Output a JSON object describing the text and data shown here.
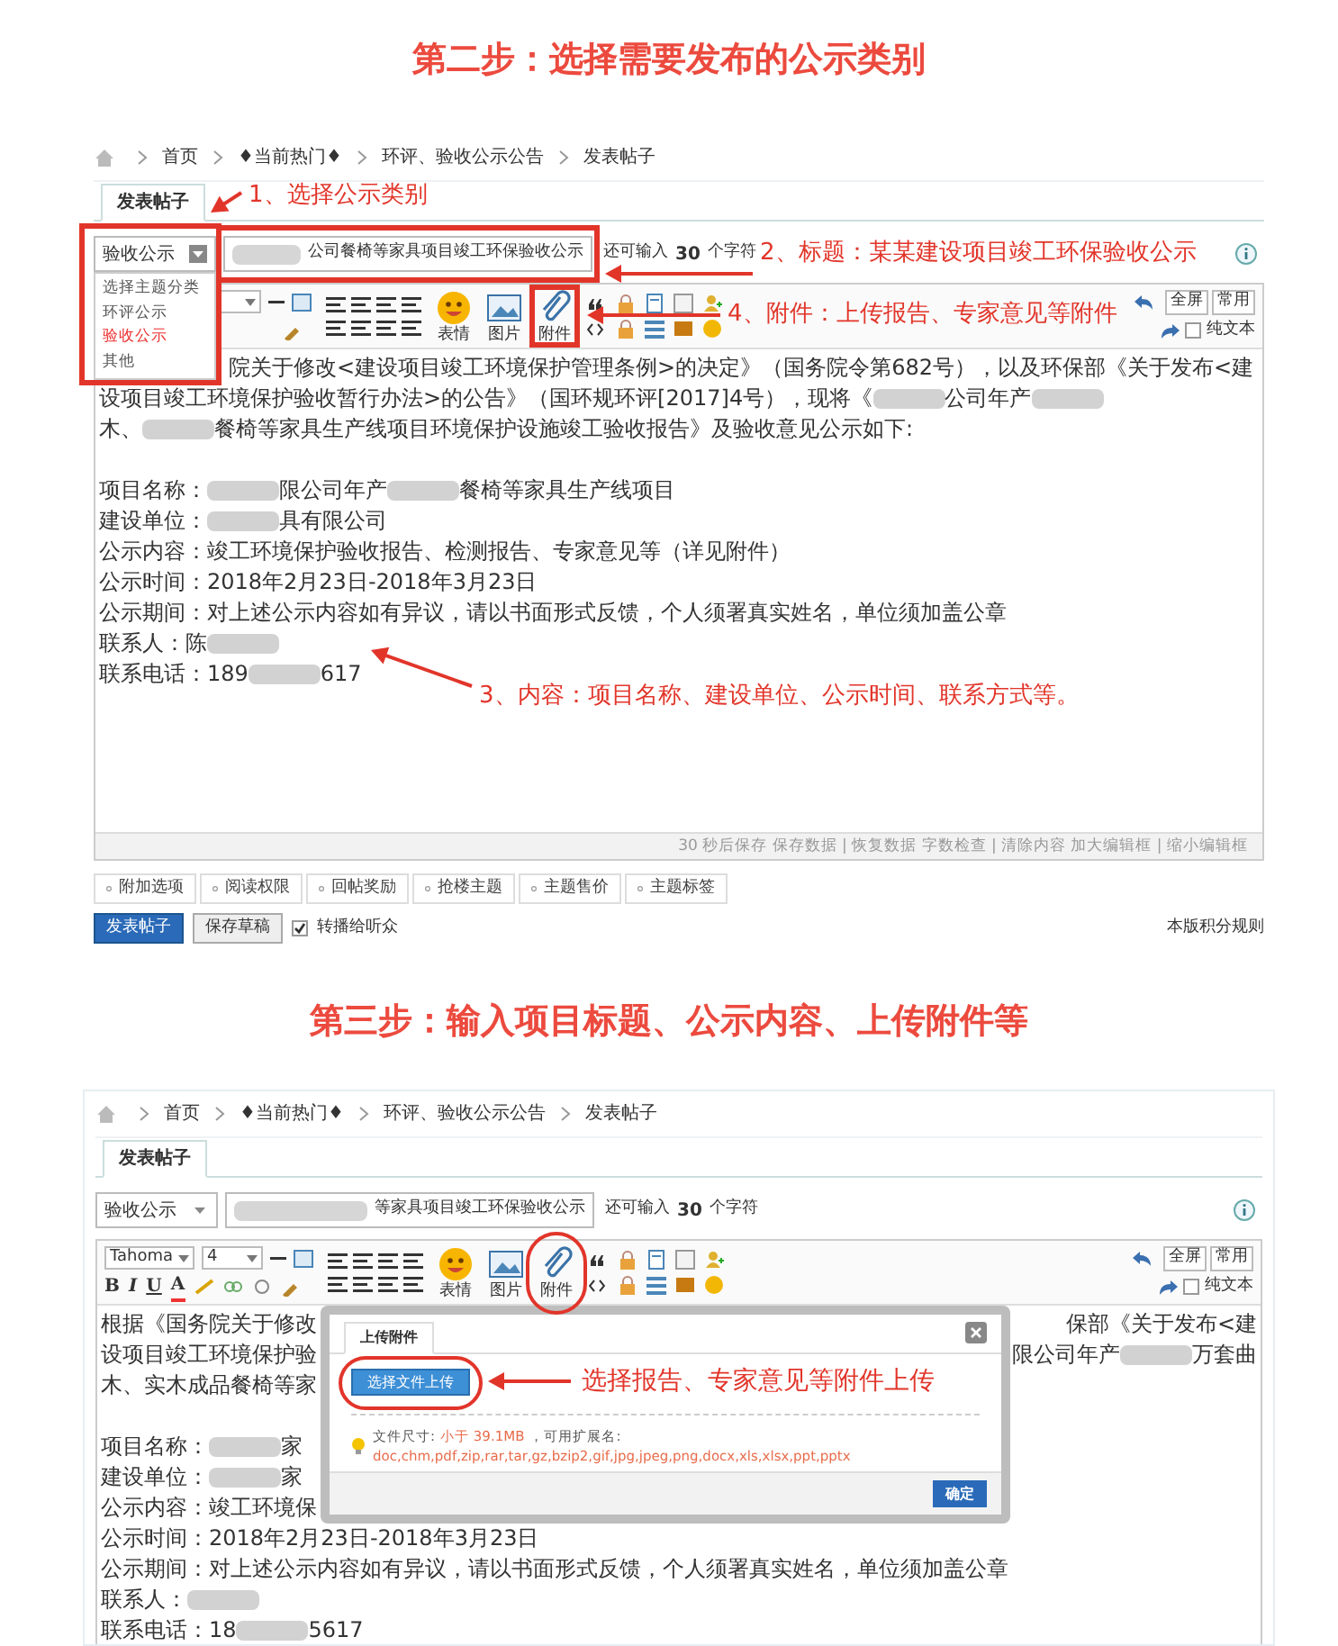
{
  "steps": [
    {
      "heading": "第二步：选择需要发布的公示类别",
      "screen": {
        "breadcrumb": [
          "首页",
          "♦当前热门♦",
          "环评、验收公示公告",
          "发表帖子"
        ],
        "tab": "发表帖子",
        "category": {
          "value": "验收公示",
          "expanded": true,
          "options": [
            {
              "label": "选择主题分类",
              "selected": false
            },
            {
              "label": "环评公示",
              "selected": false
            },
            {
              "label": "验收公示",
              "selected": true
            },
            {
              "label": "其他",
              "selected": false
            }
          ]
        },
        "title_field": {
          "value": "公司餐椅等家具项目竣工环保验收公示",
          "prefix_redacted": true
        },
        "counter": {
          "before": "还可输入",
          "count": "30",
          "after": "个字符"
        },
        "toolbar": {
          "buttons": [
            "表情",
            "图片",
            "附件"
          ],
          "right": [
            "全屏",
            "常用"
          ],
          "plain_text": {
            "label": "纯文本",
            "checked": false
          }
        },
        "body": [
          [
            {
              "kind": "hidden"
            },
            {
              "kind": "text",
              "text": "院关于修改<建设项目竣工环境保护管理条例>的决定》（国务院令第682号），以及环保部《关于发布<建"
            }
          ],
          [
            {
              "kind": "text",
              "text": "设项目竣工环境保护验收暂行办法>的公告》（国环规环评[2017]4号），现将《"
            },
            {
              "kind": "redacted"
            },
            {
              "kind": "text",
              "text": "公司年产"
            },
            {
              "kind": "redacted"
            }
          ],
          [
            {
              "kind": "text",
              "text": "木、"
            },
            {
              "kind": "redacted"
            },
            {
              "kind": "text",
              "text": "餐椅等家具生产线项目环境保护设施竣工验收报告》及验收意见公示如下:"
            }
          ],
          [
            {
              "kind": "blank"
            }
          ],
          [
            {
              "kind": "text",
              "text": "项目名称："
            },
            {
              "kind": "redacted"
            },
            {
              "kind": "text",
              "text": "限公司年产"
            },
            {
              "kind": "redacted"
            },
            {
              "kind": "text",
              "text": "餐椅等家具生产线项目"
            }
          ],
          [
            {
              "kind": "text",
              "text": "建设单位："
            },
            {
              "kind": "redacted"
            },
            {
              "kind": "text",
              "text": "具有限公司"
            }
          ],
          [
            {
              "kind": "text",
              "text": "公示内容：竣工环境保护验收报告、检测报告、专家意见等（详见附件）"
            }
          ],
          [
            {
              "kind": "text",
              "text": "公示时间：2018年2月23日-2018年3月23日"
            }
          ],
          [
            {
              "kind": "text",
              "text": "公示期间：对上述公示内容如有异议，请以书面形式反馈，个人须署真实姓名，单位须加盖公章"
            }
          ],
          [
            {
              "kind": "text",
              "text": "联系人：陈"
            },
            {
              "kind": "redacted"
            }
          ],
          [
            {
              "kind": "text",
              "text": "联系电话：189"
            },
            {
              "kind": "redacted"
            },
            {
              "kind": "text",
              "text": "617"
            }
          ]
        ],
        "status_bar": "30 秒后保存 保存数据 | 恢复数据 字数检查 | 清除内容 加大编辑框 | 缩小编辑框",
        "option_tabs": [
          "附加选项",
          "阅读权限",
          "回帖奖励",
          "抢楼主题",
          "主题售价",
          "主题标签"
        ],
        "actions": {
          "publish": "发表帖子",
          "draft": "保存草稿",
          "broadcast": {
            "label": "转播给听众",
            "checked": true
          },
          "rules_link": "本版积分规则"
        },
        "annotations": [
          {
            "kind": "category",
            "text": "1、选择公示类别"
          },
          {
            "kind": "title",
            "text": "2、标题：某某建设项目竣工环保验收公示"
          },
          {
            "kind": "attach",
            "text": "4、附件：上传报告、专家意见等附件"
          },
          {
            "kind": "content",
            "text": "3、内容：项目名称、建设单位、公示时间、联系方式等。"
          }
        ]
      }
    },
    {
      "heading": "第三步：输入项目标题、公示内容、上传附件等",
      "screen": {
        "breadcrumb": [
          "首页",
          "♦当前热门♦",
          "环评、验收公示公告",
          "发表帖子"
        ],
        "tab": "发表帖子",
        "category": {
          "value": "验收公示",
          "expanded": false
        },
        "title_field": {
          "value": "等家具项目竣工环保验收公示",
          "prefix_redacted": true
        },
        "counter": {
          "before": "还可输入",
          "count": "30",
          "after": "个字符"
        },
        "toolbar": {
          "font": "Tahoma",
          "size": "4",
          "format_letters": [
            "B",
            "I",
            "U",
            "A"
          ],
          "buttons": [
            "表情",
            "图片",
            "附件"
          ],
          "right": [
            "全屏",
            "常用"
          ],
          "plain_text": {
            "label": "纯文本",
            "checked": false
          }
        },
        "body": [
          [
            {
              "kind": "text",
              "text": "根据《国务院关于修改"
            },
            {
              "kind": "hidden"
            },
            {
              "kind": "text",
              "text": "保部《关于发布<建"
            }
          ],
          [
            {
              "kind": "text",
              "text": "设项目竣工环境保护验"
            },
            {
              "kind": "hidden"
            },
            {
              "kind": "text",
              "text": "限公司年产"
            },
            {
              "kind": "redacted"
            },
            {
              "kind": "text",
              "text": "万套曲"
            }
          ],
          [
            {
              "kind": "text",
              "text": "木、实木成品餐椅等家"
            },
            {
              "kind": "hidden"
            }
          ],
          [
            {
              "kind": "blank"
            }
          ],
          [
            {
              "kind": "text",
              "text": "项目名称："
            },
            {
              "kind": "redacted"
            },
            {
              "kind": "text",
              "text": "家"
            },
            {
              "kind": "hidden"
            }
          ],
          [
            {
              "kind": "text",
              "text": "建设单位："
            },
            {
              "kind": "redacted"
            },
            {
              "kind": "text",
              "text": "家"
            },
            {
              "kind": "hidden"
            }
          ],
          [
            {
              "kind": "text",
              "text": "公示内容：竣工环境保"
            },
            {
              "kind": "hidden"
            }
          ],
          [
            {
              "kind": "text",
              "text": "公示时间：2018年2月23日-2018年3月23日"
            }
          ],
          [
            {
              "kind": "text",
              "text": "公示期间：对上述公示内容如有异议，请以书面形式反馈，个人须署真实姓名，单位须加盖公章"
            }
          ],
          [
            {
              "kind": "text",
              "text": "联系人："
            },
            {
              "kind": "redacted"
            }
          ],
          [
            {
              "kind": "text",
              "text": "联系电话：18"
            },
            {
              "kind": "redacted"
            },
            {
              "kind": "text",
              "text": "5617"
            }
          ]
        ],
        "dialog": {
          "tab": "上传附件",
          "button": "选择文件上传",
          "size_label": "文件尺寸:",
          "size_value": "小于 39.1MB",
          "ext_label": "，可用扩展名:",
          "extensions": "doc,chm,pdf,zip,rar,tar,gz,bzip2,gif,jpg,jpeg,png,docx,xls,xlsx,ppt,pptx",
          "ok": "确定"
        },
        "annotations": [
          {
            "kind": "attach_circle"
          },
          {
            "kind": "upload",
            "text": "选择报告、专家意见等附件上传"
          }
        ]
      }
    }
  ]
}
